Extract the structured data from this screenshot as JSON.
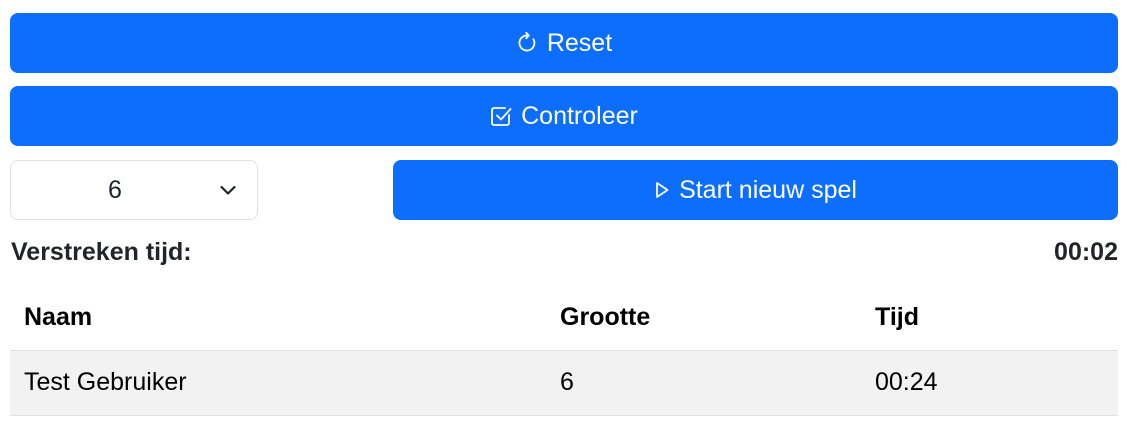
{
  "actions": {
    "reset_label": "Reset",
    "check_label": "Controleer",
    "start_label": "Start nieuw spel"
  },
  "size_select": {
    "selected": "6"
  },
  "timer": {
    "label": "Verstreken tijd:",
    "value": "00:02"
  },
  "scores": {
    "headers": [
      "Naam",
      "Grootte",
      "Tijd"
    ],
    "rows": [
      [
        "Test Gebruiker",
        "6",
        "00:24"
      ]
    ]
  },
  "colors": {
    "primary": "#0d6efd",
    "row_bg": "#f2f2f2",
    "border": "#dee2e6"
  },
  "icons": {
    "reset": "rotate-cw-icon",
    "check": "check-square-icon",
    "start": "play-icon",
    "select": "chevron-down-icon"
  }
}
